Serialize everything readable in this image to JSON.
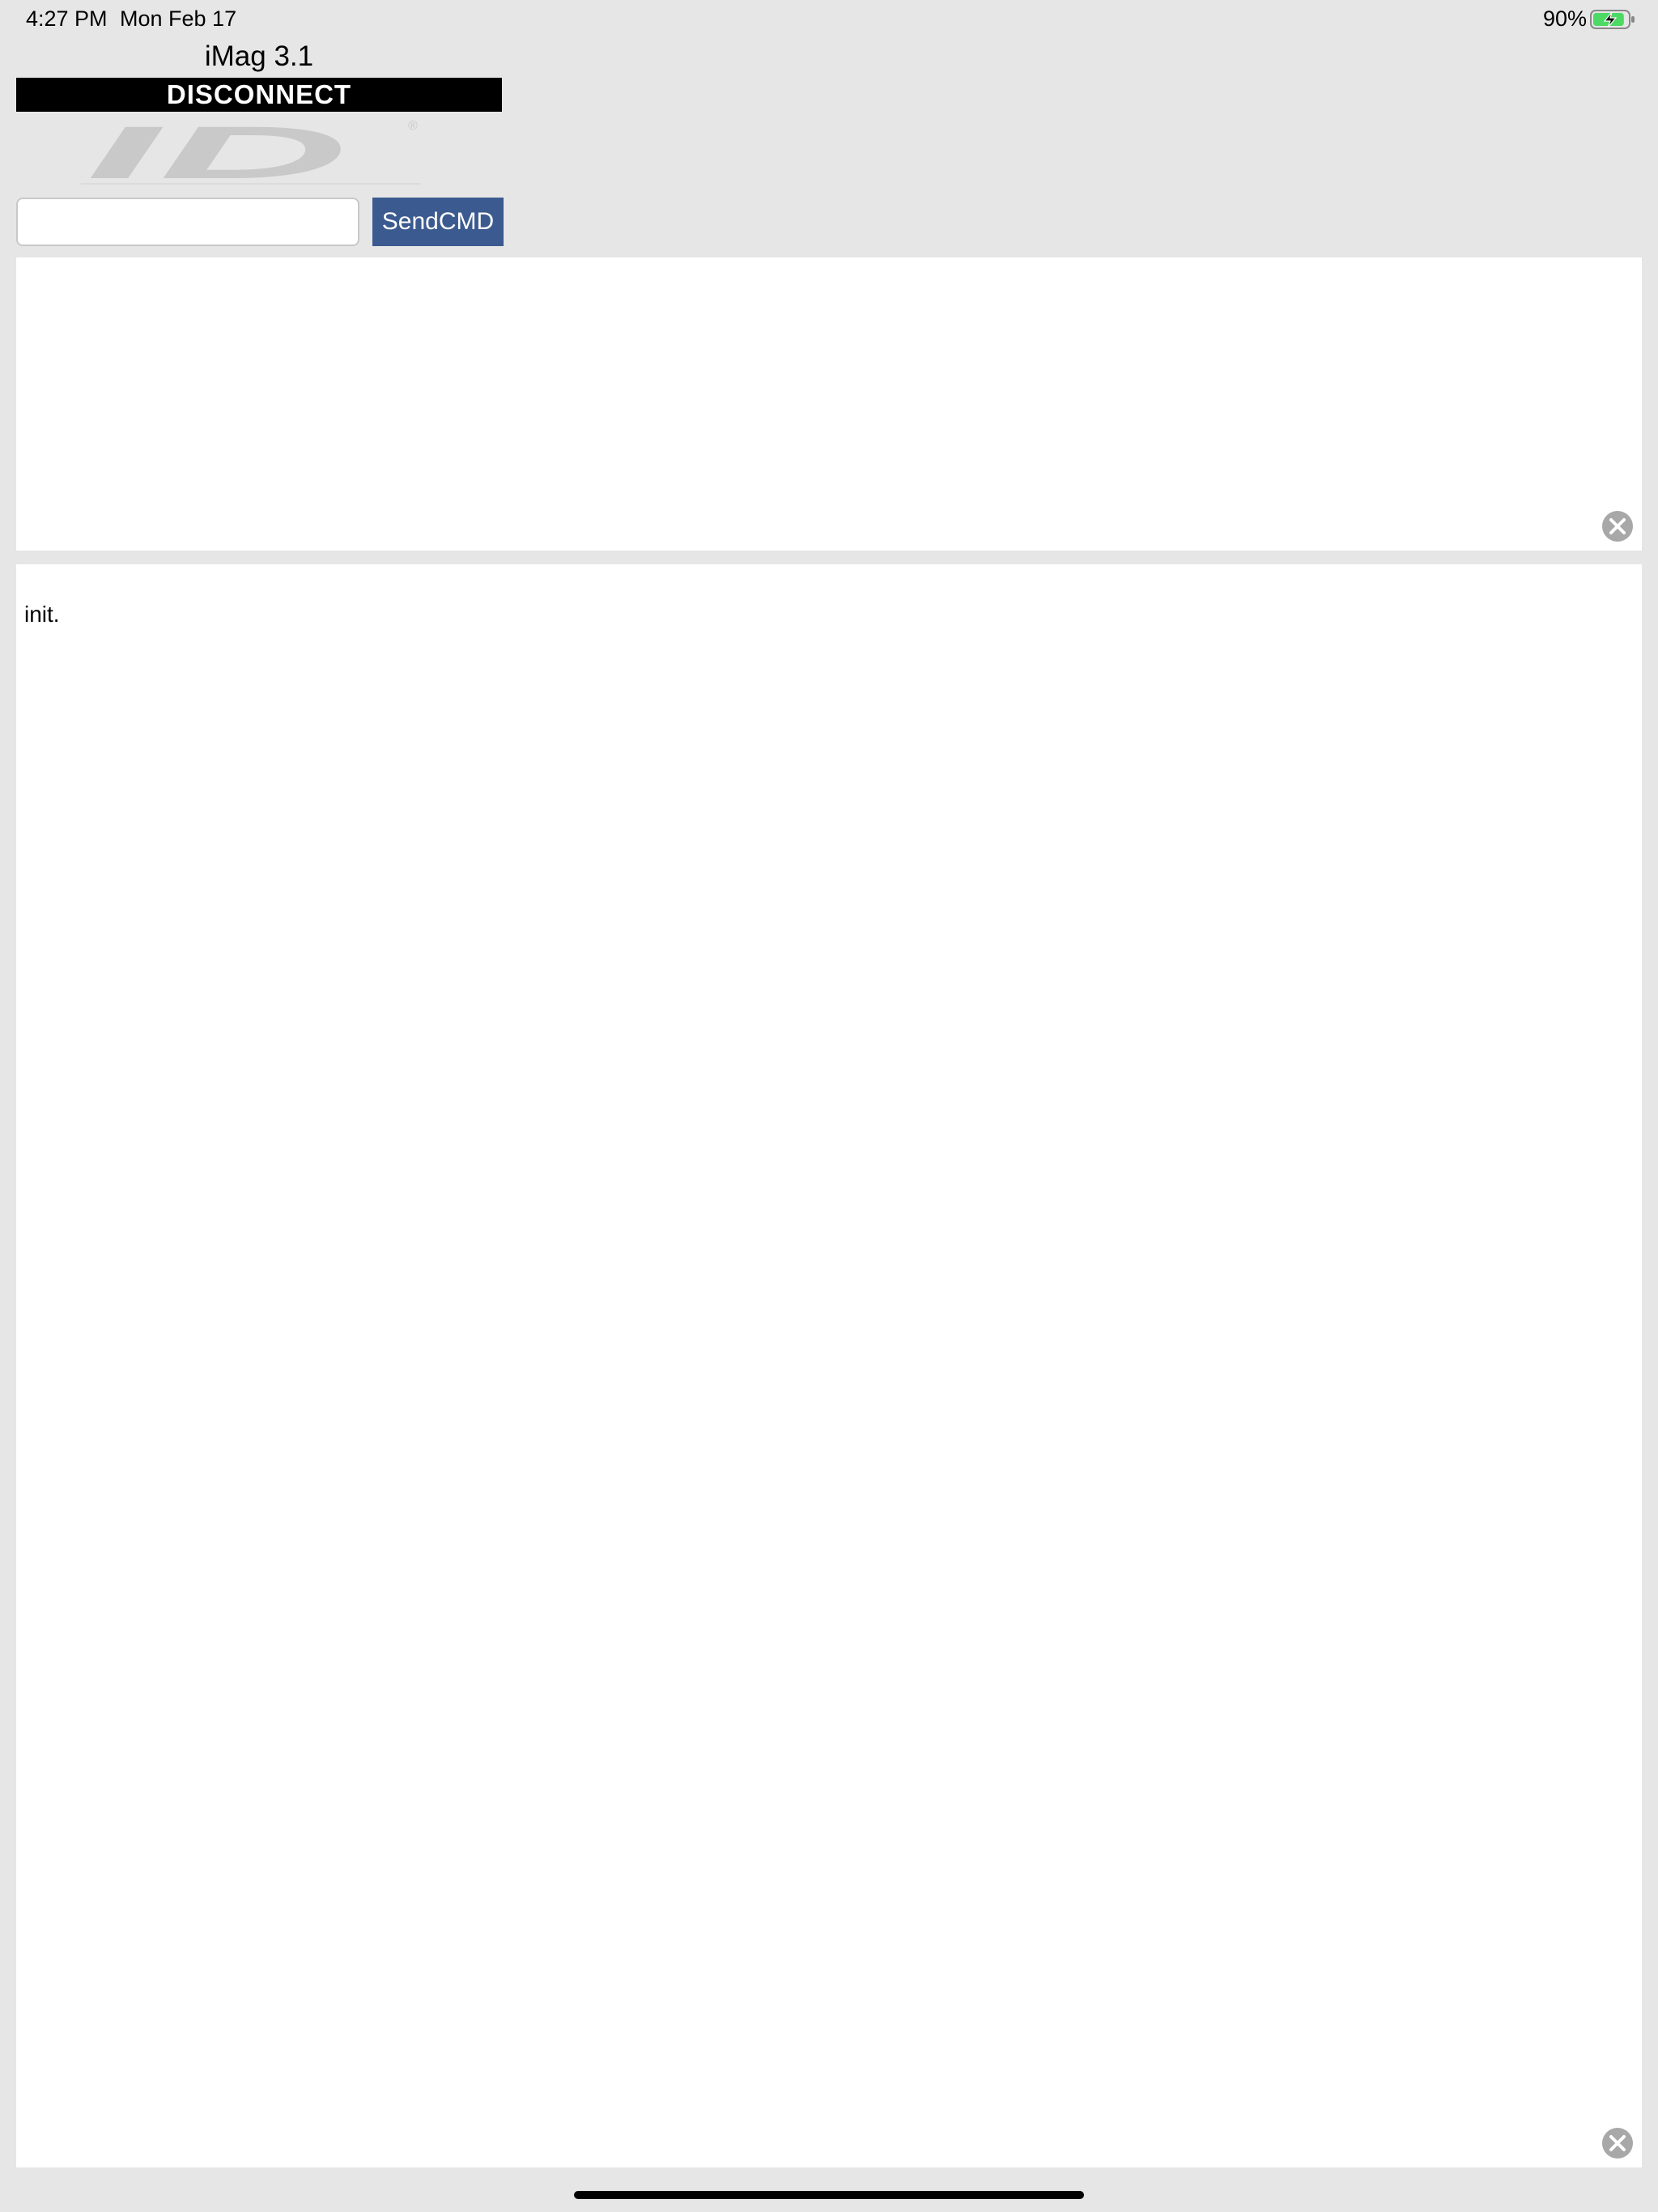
{
  "status_bar": {
    "time": "4:27 PM",
    "date": "Mon Feb 17",
    "battery_percent": "90%",
    "battery_level": 0.9,
    "battery_icon": "battery-charging-icon"
  },
  "app": {
    "title": "iMag 3.1",
    "disconnect_label": "DISCONNECT",
    "logo_text": "IDTECH"
  },
  "command": {
    "input_value": "",
    "input_placeholder": "",
    "send_label": "SendCMD"
  },
  "panels": {
    "top_text": "",
    "bottom_text": "init."
  },
  "colors": {
    "send_button": "#3b5a8f",
    "disconnect_bg": "#000000",
    "background": "#e6e6e6",
    "logo_grey": "#c9c9c9",
    "logo_green": "#8fcfa6"
  }
}
